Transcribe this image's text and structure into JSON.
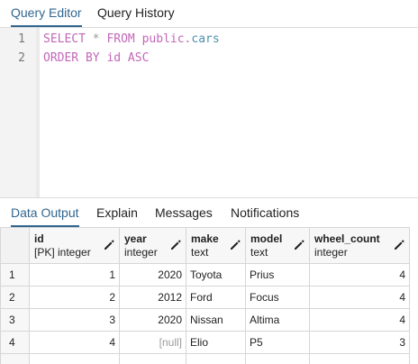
{
  "top_tabs": {
    "query_editor": "Query Editor",
    "query_history": "Query History"
  },
  "editor": {
    "lines": [
      {
        "number": "1",
        "tokens": [
          "SELECT",
          "*",
          "FROM",
          "public.",
          "cars"
        ]
      },
      {
        "number": "2",
        "tokens": [
          "ORDER BY id ASC"
        ]
      }
    ]
  },
  "bottom_tabs": {
    "data_output": "Data Output",
    "explain": "Explain",
    "messages": "Messages",
    "notifications": "Notifications"
  },
  "columns": [
    {
      "name": "id",
      "type": "[PK] integer"
    },
    {
      "name": "year",
      "type": "integer"
    },
    {
      "name": "make",
      "type": "text"
    },
    {
      "name": "model",
      "type": "text"
    },
    {
      "name": "wheel_count",
      "type": "integer"
    }
  ],
  "rows": [
    {
      "n": "1",
      "id": "1",
      "year": "2020",
      "make": "Toyota",
      "model": "Prius",
      "wheel_count": "4"
    },
    {
      "n": "2",
      "id": "2",
      "year": "2012",
      "make": "Ford",
      "model": "Focus",
      "wheel_count": "4"
    },
    {
      "n": "3",
      "id": "3",
      "year": "2020",
      "make": "Nissan",
      "model": "Altima",
      "wheel_count": "4"
    },
    {
      "n": "4",
      "id": "4",
      "year": "[null]",
      "make": "Elio",
      "model": "P5",
      "wheel_count": "3"
    }
  ],
  "colors": {
    "accent": "#326690",
    "keyword": "#c267b8",
    "identifier": "#4c8fb0",
    "null_text": "#9a9a9a"
  },
  "icons": {
    "edit_column": "pencil-icon"
  }
}
